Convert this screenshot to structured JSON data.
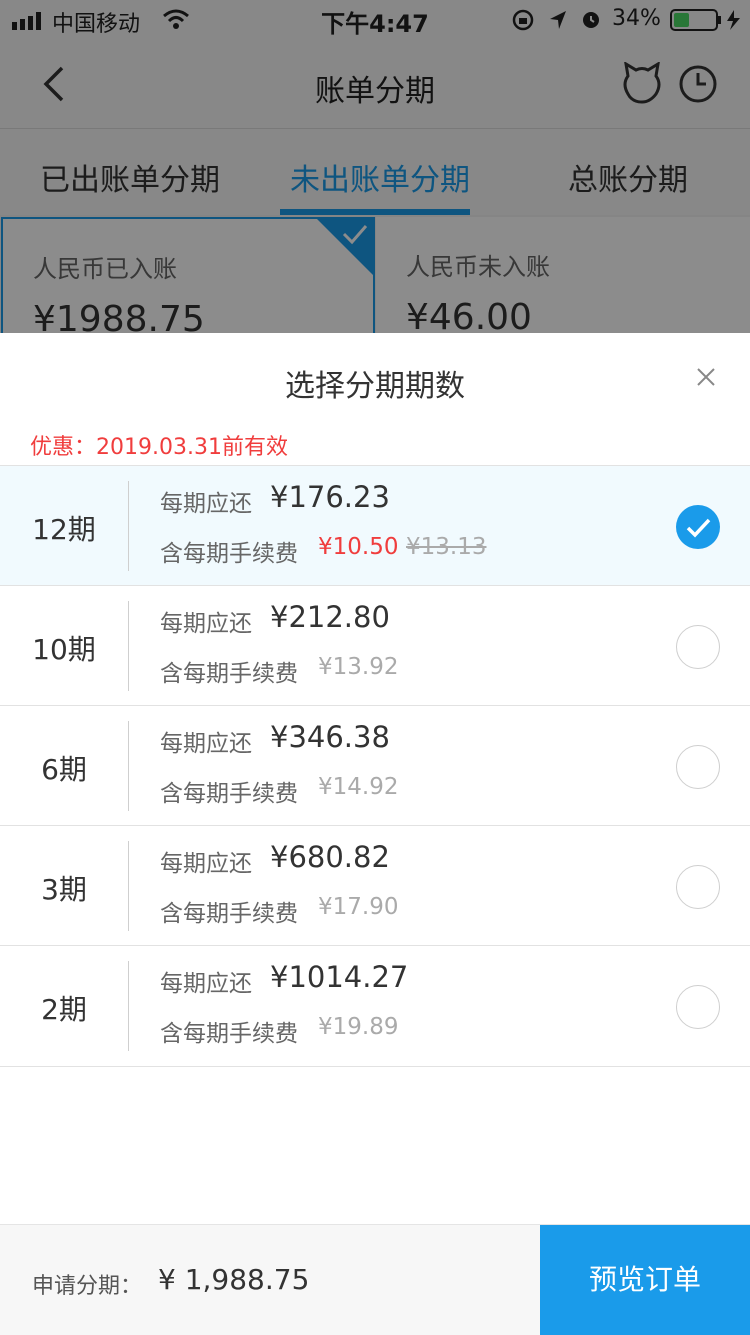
{
  "status": {
    "carrier": "中国移动",
    "time": "下午4:47",
    "battery": "34%"
  },
  "nav": {
    "title": "账单分期"
  },
  "tabs": [
    {
      "label": "已出账单分期"
    },
    {
      "label": "未出账单分期"
    },
    {
      "label": "总账分期"
    }
  ],
  "cards": [
    {
      "label": "人民币已入账",
      "amount": "¥1988.75"
    },
    {
      "label": "人民币未入账",
      "amount": "¥46.00"
    }
  ],
  "sheet": {
    "title": "选择分期期数",
    "promo": "优惠：2019.03.31前有效",
    "per_label": "每期应还",
    "fee_label": "含每期手续费",
    "options": [
      {
        "period": "12期",
        "amount": "¥176.23",
        "fee": "¥10.50",
        "fee_old": "¥13.13",
        "selected": true
      },
      {
        "period": "10期",
        "amount": "¥212.80",
        "fee": "¥13.92",
        "selected": false
      },
      {
        "period": "6期",
        "amount": "¥346.38",
        "fee": "¥14.92",
        "selected": false
      },
      {
        "period": "3期",
        "amount": "¥680.82",
        "fee": "¥17.90",
        "selected": false
      },
      {
        "period": "2期",
        "amount": "¥1014.27",
        "fee": "¥19.89",
        "selected": false
      }
    ]
  },
  "bottom": {
    "apply_label": "申请分期：",
    "total": "¥ 1,988.75",
    "button": "预览订单"
  },
  "colors": {
    "accent": "#1a9bea",
    "promo": "#f03d3d"
  }
}
